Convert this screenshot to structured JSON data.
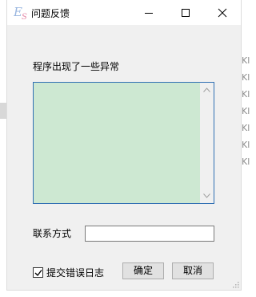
{
  "window": {
    "title": "问题反馈",
    "app_icon": "es-app-icon"
  },
  "titlebar": {
    "minimize_icon": "minimize-icon",
    "maximize_icon": "maximize-icon",
    "close_icon": "close-icon"
  },
  "form": {
    "error_label": "程序出现了一些异常",
    "details_value": "",
    "contact_label": "联系方式",
    "contact_value": "",
    "submit_log_label": "提交错误日志",
    "submit_log_checked": true,
    "ok_label": "确定",
    "cancel_label": "取消"
  },
  "background": {
    "rows": [
      "Kl",
      "Kl",
      "Kl",
      "Kl",
      "Kl",
      "Kl",
      "Kl"
    ]
  },
  "colors": {
    "textarea_bg": "#cde8d2",
    "textarea_border": "#2f6fb3",
    "window_bg": "#f0f0f0"
  }
}
